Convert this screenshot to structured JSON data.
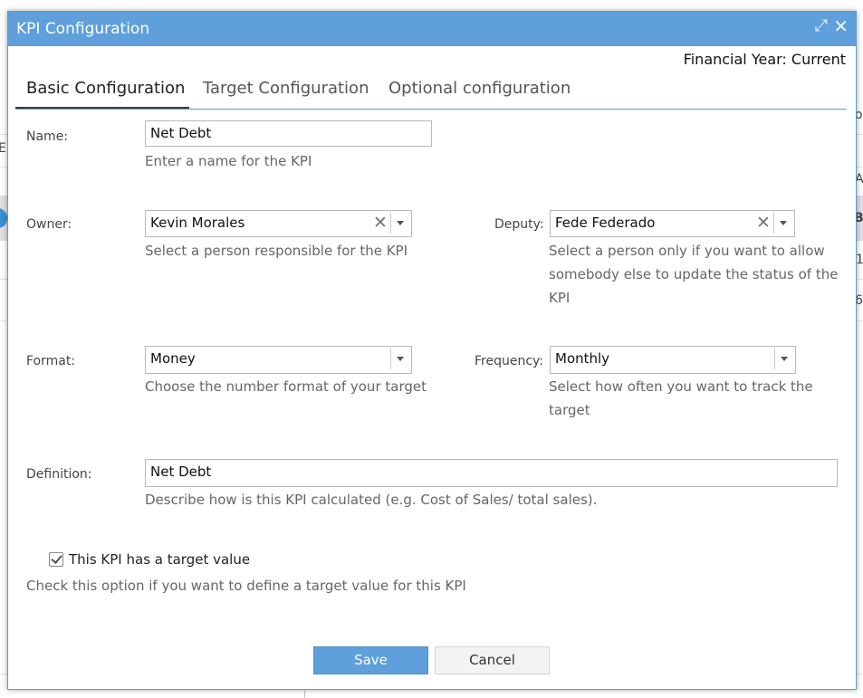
{
  "background": {
    "fragments": [
      "o",
      "El",
      "A",
      "B",
      "1",
      "6"
    ]
  },
  "dialog": {
    "title": "KPI Configuration",
    "expand_icon": "expand-icon",
    "close_icon": "close-icon",
    "financial_year": "Financial Year: Current",
    "tabs": [
      {
        "label": "Basic Configuration",
        "active": true
      },
      {
        "label": "Target Configuration",
        "active": false
      },
      {
        "label": "Optional configuration",
        "active": false
      }
    ],
    "fields": {
      "name": {
        "label": "Name:",
        "value": "Net Debt",
        "hint": "Enter a name for the KPI"
      },
      "owner": {
        "label": "Owner:",
        "value": "Kevin Morales",
        "hint": "Select a person responsible for the KPI"
      },
      "deputy": {
        "label": "Deputy:",
        "value": "Fede Federado",
        "hint": "Select a person only if you want to allow somebody else to update the status of the KPI"
      },
      "format": {
        "label": "Format:",
        "value": "Money",
        "hint": "Choose the number format of your target"
      },
      "frequency": {
        "label": "Frequency:",
        "value": "Monthly",
        "hint": "Select how often you want to track the target"
      },
      "definition": {
        "label": "Definition:",
        "value": "Net Debt",
        "hint": "Describe how is this KPI calculated (e.g. Cost of Sales/ total sales)."
      }
    },
    "target_checkbox": {
      "label": "This KPI has a target value",
      "checked": true,
      "hint": "Check this option if you want to define a target value for this KPI"
    },
    "buttons": {
      "save": "Save",
      "cancel": "Cancel"
    },
    "colors": {
      "titlebar": "#5e9fdc",
      "primary_button": "#5e9fdc",
      "tab_line": "#5b9bd5"
    }
  }
}
